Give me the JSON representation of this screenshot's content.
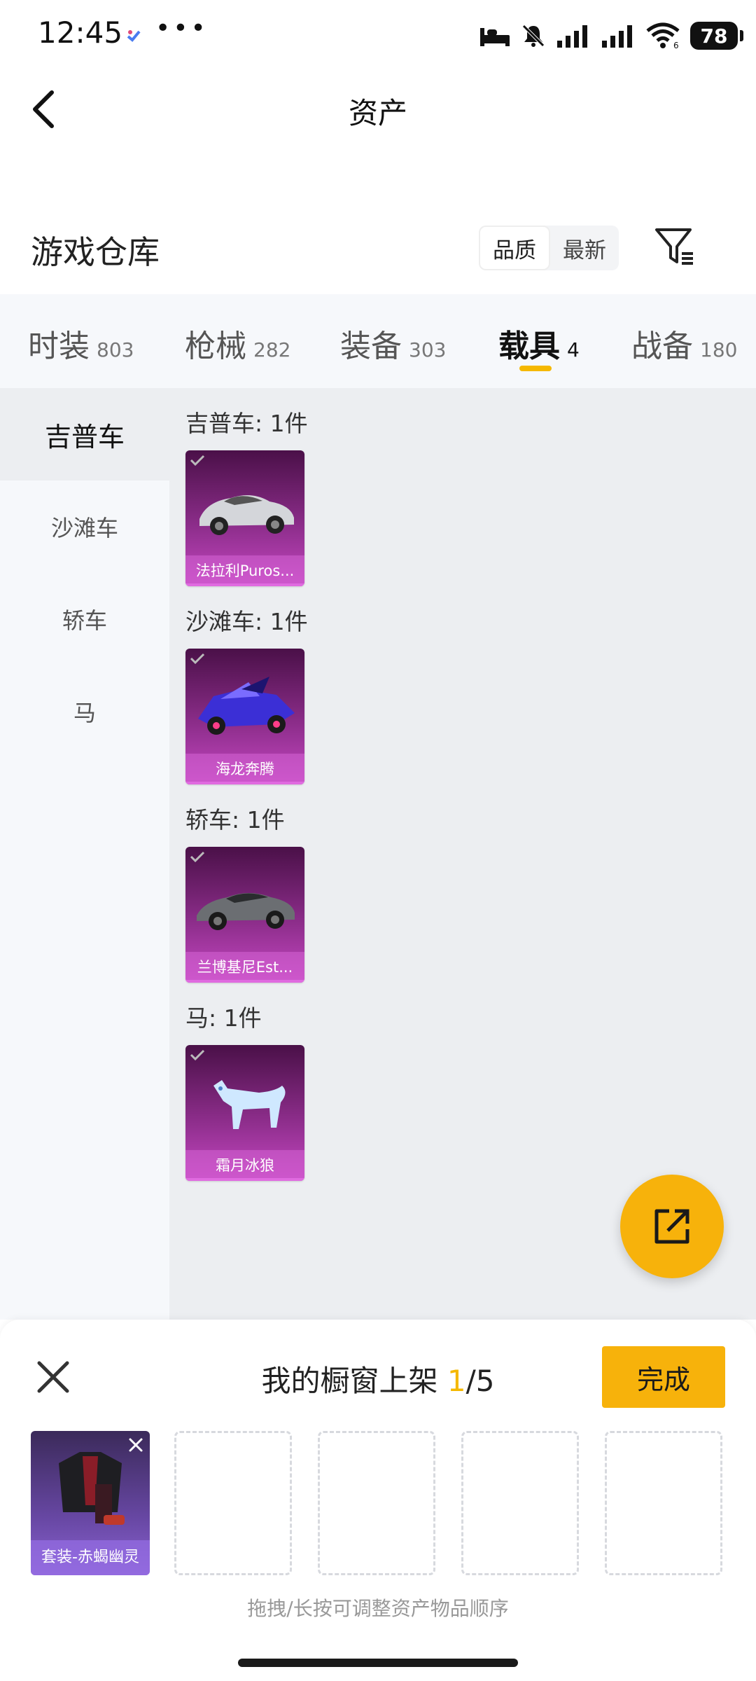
{
  "status": {
    "time": "12:45",
    "more": "•••",
    "battery": "78"
  },
  "nav": {
    "title": "资产"
  },
  "warehouse": {
    "title": "游戏仓库",
    "sort_options": [
      "品质",
      "最新"
    ],
    "sort_selected": "品质"
  },
  "tabs": [
    {
      "label": "时装",
      "count": "803"
    },
    {
      "label": "枪械",
      "count": "282"
    },
    {
      "label": "装备",
      "count": "303"
    },
    {
      "label": "载具",
      "count": "4",
      "active": true
    },
    {
      "label": "战备",
      "count": "180"
    }
  ],
  "subnav": [
    {
      "label": "吉普车",
      "active": true
    },
    {
      "label": "沙滩车"
    },
    {
      "label": "轿车"
    },
    {
      "label": "马"
    }
  ],
  "groups": [
    {
      "title": "吉普车: 1件",
      "item": "法拉利Puros...",
      "thumb": "silver-sports-car"
    },
    {
      "title": "沙滩车: 1件",
      "item": "海龙奔腾",
      "thumb": "purple-buggy"
    },
    {
      "title": "轿车: 1件",
      "item": "兰博基尼Est...",
      "thumb": "gray-sedan"
    },
    {
      "title": "马: 1件",
      "item": "霜月冰狼",
      "thumb": "ice-wolf"
    }
  ],
  "sheet": {
    "title": "我的橱窗上架 ",
    "current": "1",
    "total": "/5",
    "done_label": "完成",
    "filled_slot_name": "套装-赤蝎幽灵",
    "hint": "拖拽/长按可调整资产物品顺序"
  },
  "colors": {
    "accent": "#f7b20b",
    "card_purple": "#8c2d8a"
  }
}
